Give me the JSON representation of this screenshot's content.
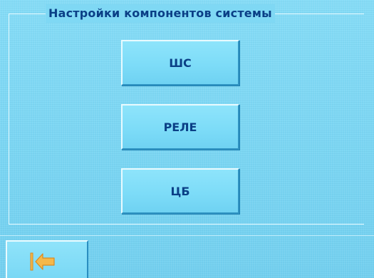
{
  "panel": {
    "title": "Настройки компонентов системы"
  },
  "menu": {
    "items": [
      {
        "label": "ШС"
      },
      {
        "label": "РЕЛЕ"
      },
      {
        "label": "ЦБ"
      }
    ]
  },
  "footer": {
    "back_icon": "back-arrow-icon",
    "icon_color": "#f5b84a"
  },
  "colors": {
    "background": "#7cd8f4",
    "text": "#0a3f86"
  }
}
